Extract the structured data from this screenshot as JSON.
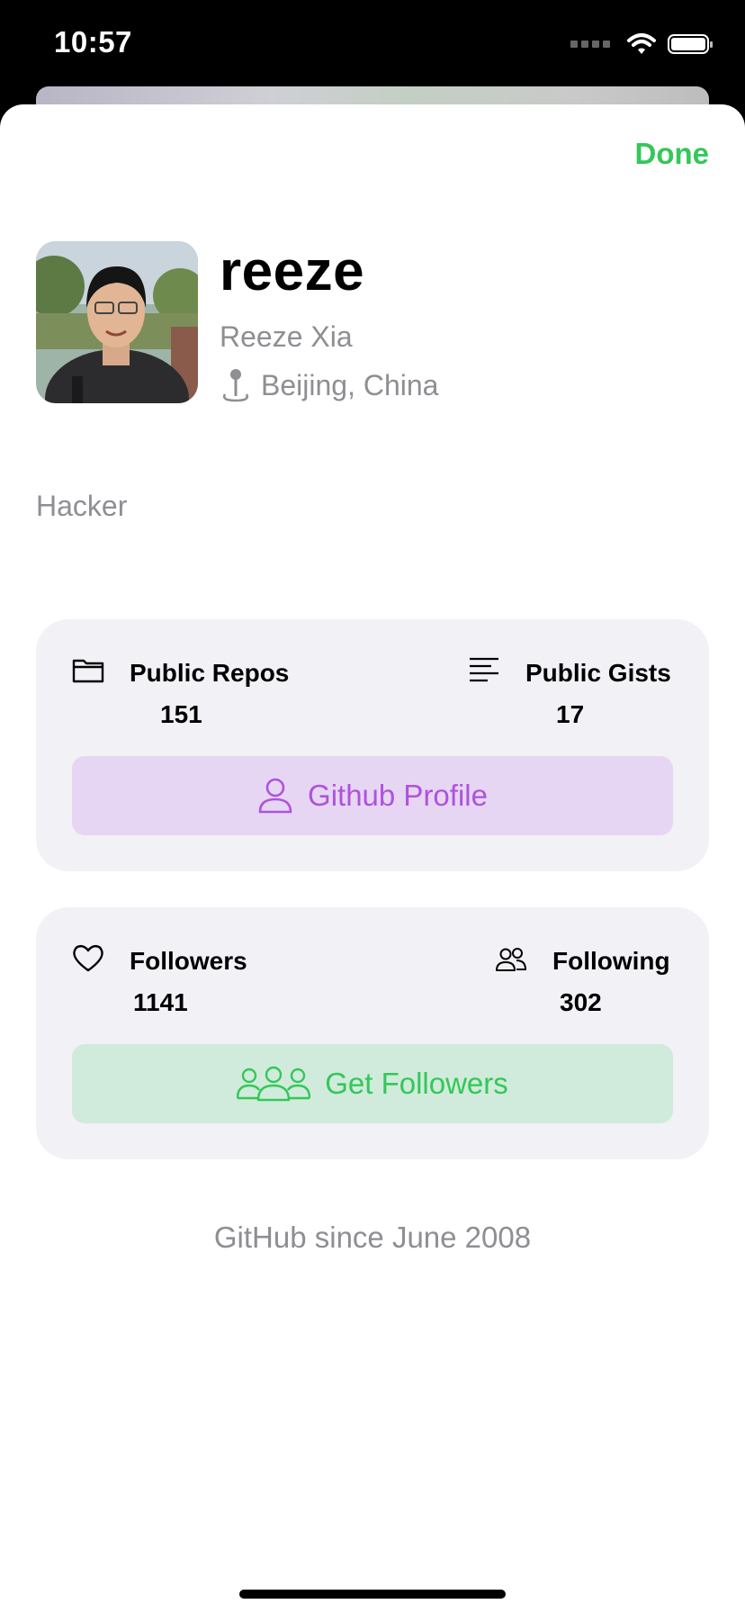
{
  "status_bar": {
    "time": "10:57"
  },
  "header": {
    "done_label": "Done"
  },
  "profile": {
    "username": "reeze",
    "full_name": "Reeze Xia",
    "location": "Beijing, China",
    "bio": "Hacker"
  },
  "repo_card": {
    "public_repos_label": "Public Repos",
    "public_repos_value": "151",
    "public_gists_label": "Public Gists",
    "public_gists_value": "17",
    "button_label": "Github Profile"
  },
  "follow_card": {
    "followers_label": "Followers",
    "followers_value": "1141",
    "following_label": "Following",
    "following_value": "302",
    "button_label": "Get Followers"
  },
  "footer": {
    "since_text": "GitHub since June 2008"
  },
  "colors": {
    "accent_green": "#34c759",
    "accent_purple": "#af52de",
    "secondary_text": "#8e8e93",
    "card_bg": "#f2f1f6"
  },
  "icons": [
    "folder-icon",
    "text-align-left-icon",
    "person-icon",
    "heart-icon",
    "person-2-icon",
    "person-3-icon",
    "pin-icon",
    "wifi-icon",
    "battery-icon"
  ]
}
